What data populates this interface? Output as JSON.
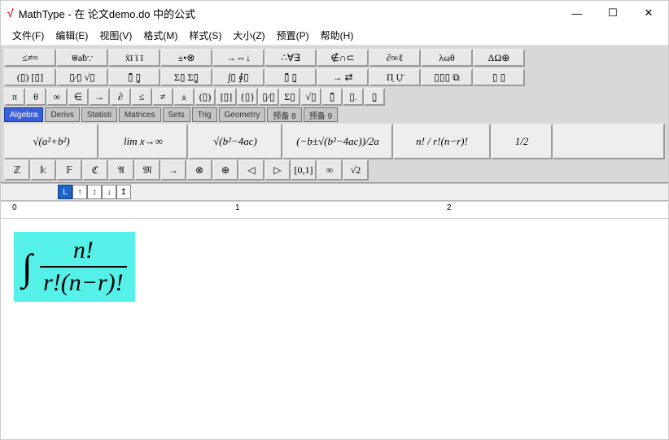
{
  "window": {
    "title": "MathType - 在 论文demo.do 中的公式"
  },
  "menu": {
    "file": "文件(F)",
    "edit": "编辑(E)",
    "view": "视图(V)",
    "format": "格式(M)",
    "style": "样式(S)",
    "size": "大小(Z)",
    "preset": "预置(P)",
    "help": "帮助(H)"
  },
  "palette_row1": [
    "≤≠≈",
    "⩐aḃ∵",
    "ẍī ï ī",
    "±•⊗",
    "→⇔↓",
    "∴∀∃",
    "∉∩⊂",
    "∂∞ℓ",
    "λωθ",
    "ΔΩ⊕"
  ],
  "palette_row2": [
    "(▯) [▯]",
    "▯⁄▯ √▯",
    "▯̄ ▯͇",
    "Σ▯ Σ▯͇",
    "∫▯ ∮▯",
    "▯̄ ▯̱",
    "→ ⇄",
    "Π̣ Ụ̈",
    "▯▯▯ ⧉",
    "▯ ▯"
  ],
  "small_row": [
    "π",
    "θ",
    "∞",
    "∈",
    "→",
    "∂",
    "≤",
    "≠",
    "±",
    "(▯)",
    "[▯]",
    "{▯}",
    "▯⁄▯",
    "Σ▯",
    "√▯",
    "▯̄",
    "▯.",
    "▯̤"
  ],
  "tabs": [
    "Algebra",
    "Derivs",
    "Statisti",
    "Matrices",
    "Sets",
    "Trig",
    "Geometry",
    "预备 8",
    "预备 9"
  ],
  "active_tab": 0,
  "expr_row": [
    "√(a²+b²)",
    "lim x→∞",
    "√(b²−4ac)",
    "(−b±√(b²−4ac))/2a",
    "n! / r!(n−r)!",
    "1/2"
  ],
  "last_row": [
    "ℤ",
    "𝕜",
    "𝔽",
    "ℭ",
    "𝔄",
    "𝔐",
    "→",
    "⊗",
    "⊕",
    "◁",
    "▷",
    "[0,1]",
    "∞",
    "√2"
  ],
  "ruler_marks": [
    "0",
    "1",
    "2"
  ],
  "formula": {
    "numerator": "n!",
    "denominator": "r!(n−r)!"
  }
}
